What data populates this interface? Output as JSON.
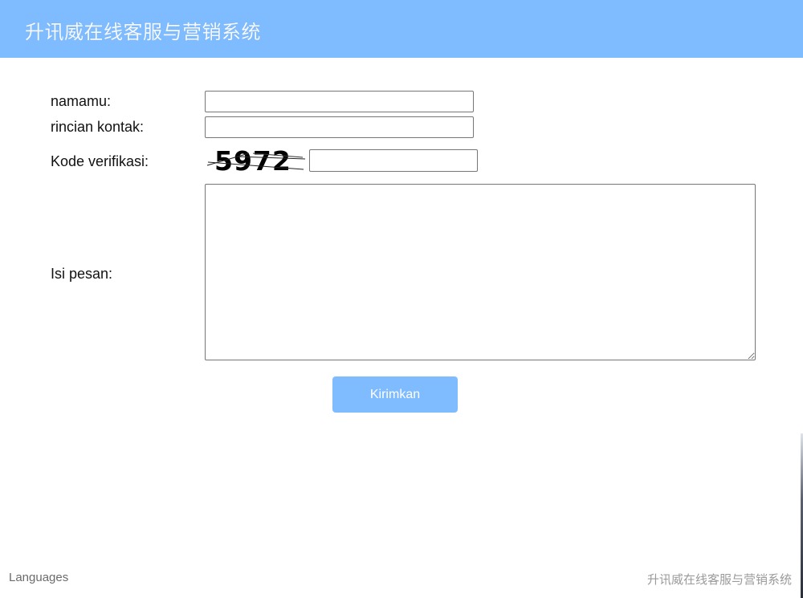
{
  "header": {
    "title": "升讯威在线客服与营销系统",
    "background": "#7fbcff"
  },
  "form": {
    "name_label": "namamu:",
    "name_value": "",
    "contact_label": "rincian kontak:",
    "contact_value": "",
    "captcha_label": "Kode verifikasi:",
    "captcha_code": "5972",
    "captcha_value": "",
    "message_label": "Isi pesan:",
    "message_value": "",
    "submit_label": "Kirimkan"
  },
  "footer": {
    "languages_label": "Languages",
    "brand": "升讯威在线客服与营销系统"
  }
}
